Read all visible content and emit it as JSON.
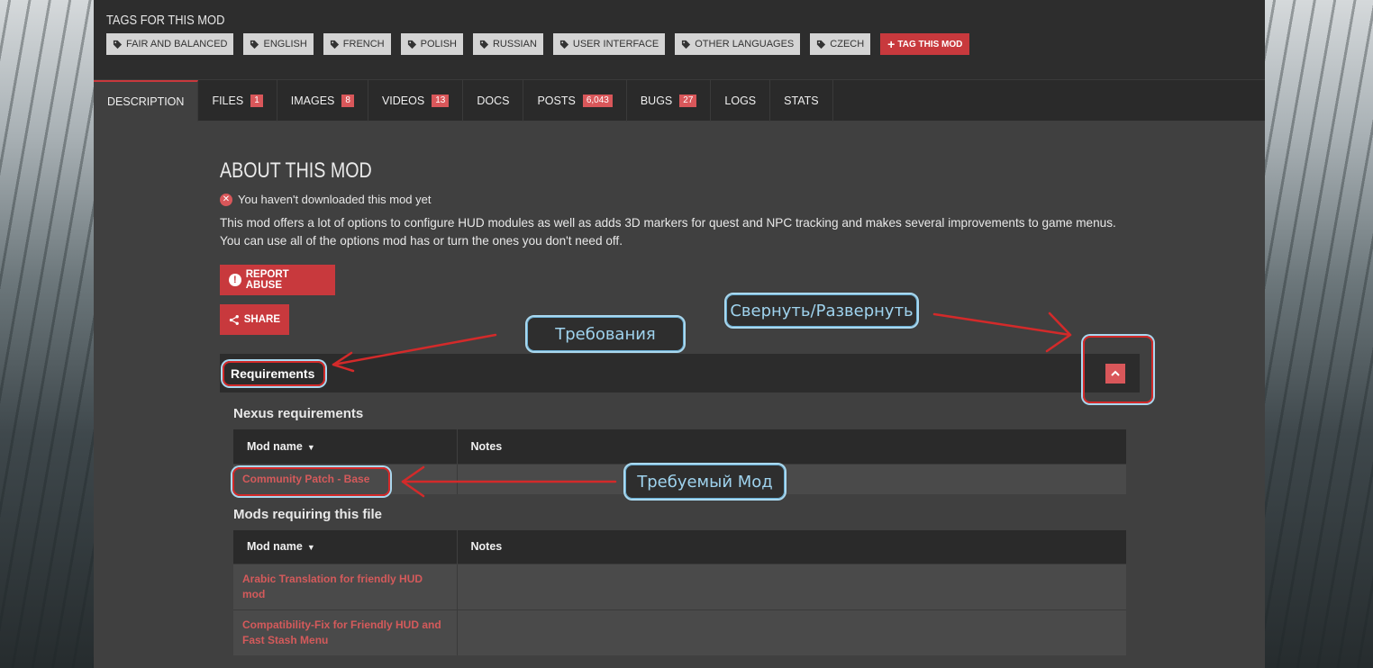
{
  "tags": {
    "title": "TAGS FOR THIS MOD",
    "items": [
      {
        "label": "FAIR AND BALANCED"
      },
      {
        "label": "ENGLISH"
      },
      {
        "label": "FRENCH"
      },
      {
        "label": "POLISH"
      },
      {
        "label": "RUSSIAN"
      },
      {
        "label": "USER INTERFACE"
      },
      {
        "label": "OTHER LANGUAGES"
      },
      {
        "label": "CZECH"
      }
    ],
    "add_label": "TAG THIS MOD",
    "tag_icon": "tag-icon",
    "accent_color": "#c8393d"
  },
  "tabs": [
    {
      "label": "DESCRIPTION",
      "count": ""
    },
    {
      "label": "FILES",
      "count": "1"
    },
    {
      "label": "IMAGES",
      "count": "8"
    },
    {
      "label": "VIDEOS",
      "count": "13"
    },
    {
      "label": "DOCS",
      "count": ""
    },
    {
      "label": "POSTS",
      "count": "6,043"
    },
    {
      "label": "BUGS",
      "count": "27"
    },
    {
      "label": "LOGS",
      "count": ""
    },
    {
      "label": "STATS",
      "count": ""
    }
  ],
  "about": {
    "title": "ABOUT THIS MOD",
    "download_status": "You haven't downloaded this mod yet",
    "description": "This mod offers a lot of options to configure HUD modules as well as adds 3D markers for quest and NPC tracking and makes several improvements to game menus. You can use all of the options mod has or turn the ones you don't need off.",
    "report_label": "REPORT ABUSE",
    "share_label": "SHARE"
  },
  "requirements": {
    "title": "Requirements",
    "nexus_title": "Nexus requirements",
    "col_mod_name": "Mod name",
    "col_notes": "Notes",
    "nexus_rows": [
      {
        "name": "Community Patch - Base",
        "notes": ""
      }
    ],
    "requiring_title": "Mods requiring this file",
    "requiring_rows": [
      {
        "name": "Arabic Translation for friendly HUD mod",
        "notes": ""
      },
      {
        "name": "Compatibility-Fix for Friendly HUD and Fast Stash Menu",
        "notes": ""
      }
    ]
  },
  "annotations": {
    "requirements_label": "Требования",
    "collapse_label": "Свернуть/Развернуть",
    "required_mod_label": "Требуемый Мод",
    "arrow_color": "#d32a2a",
    "box_color": "#a9d8ef"
  }
}
